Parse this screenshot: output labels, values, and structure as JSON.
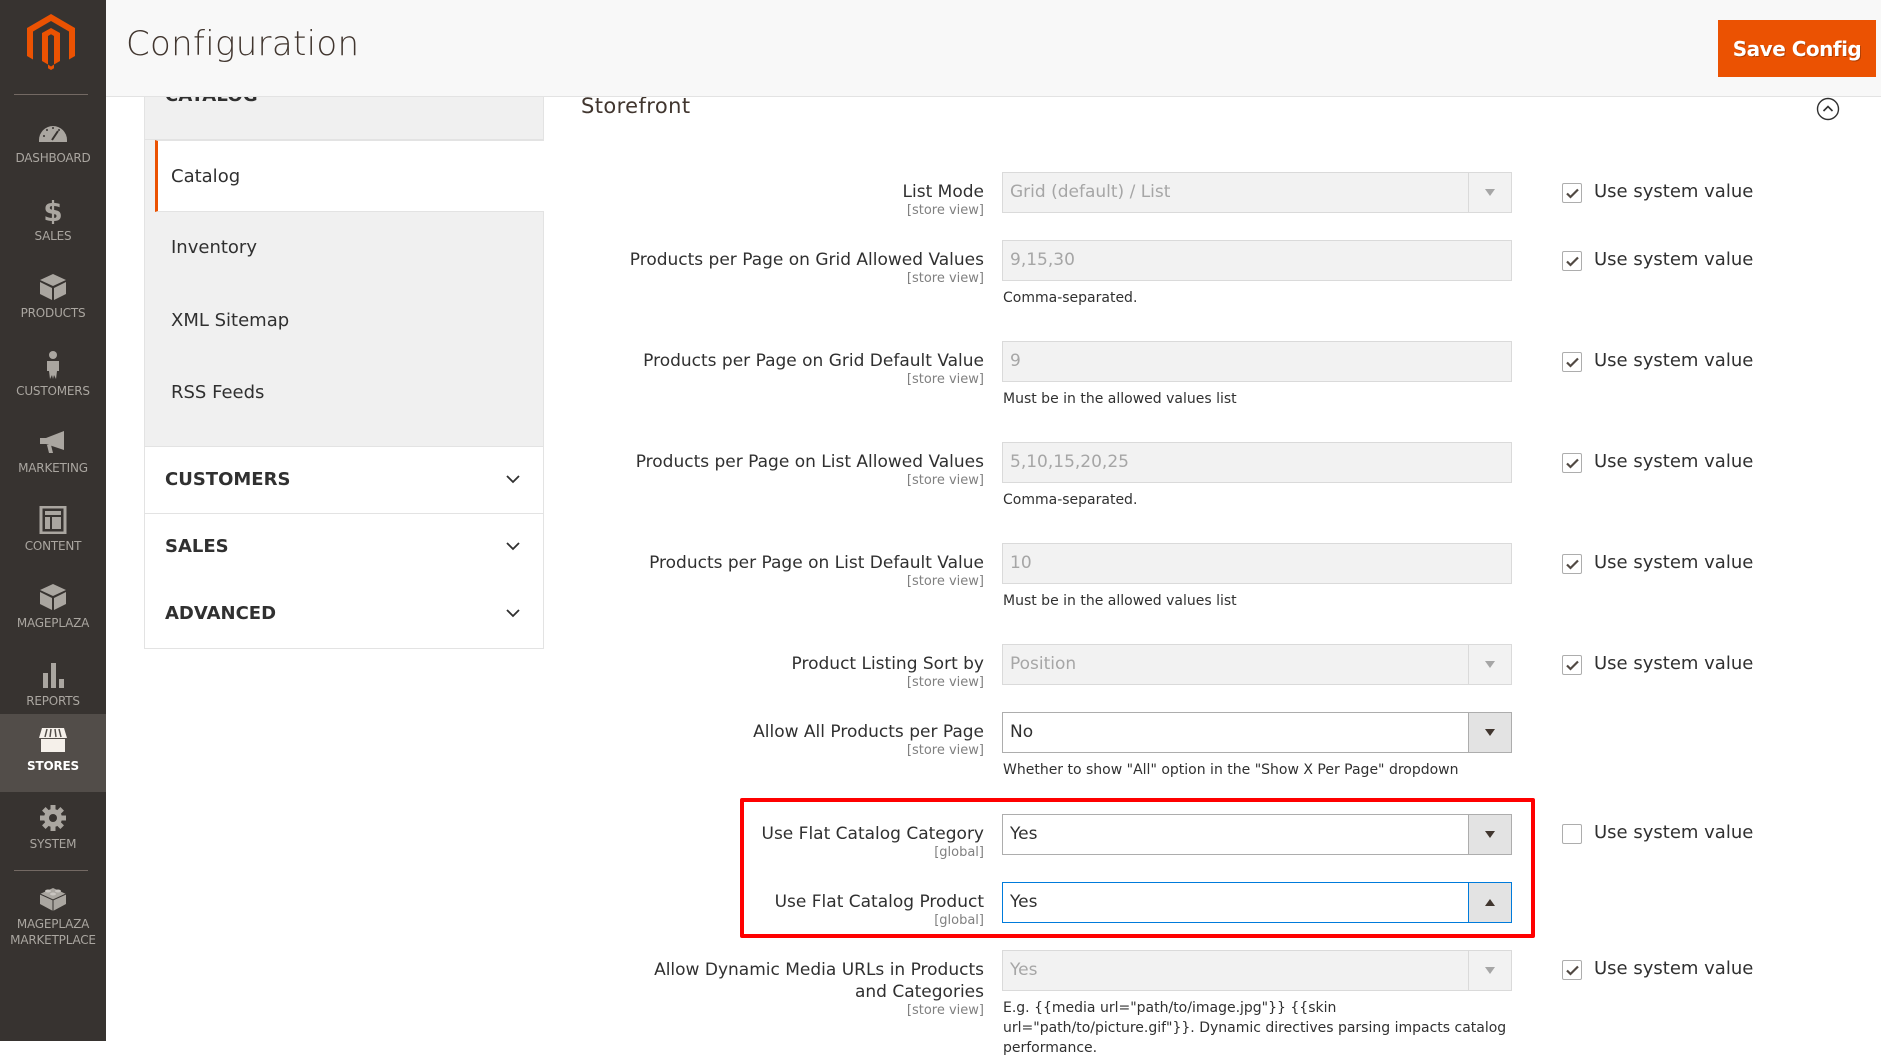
{
  "nav": {
    "items": [
      {
        "label": "DASHBOARD",
        "icon": "dashboard-icon",
        "active": false
      },
      {
        "label": "SALES",
        "icon": "dollar-icon",
        "active": false
      },
      {
        "label": "PRODUCTS",
        "icon": "box-icon",
        "active": false
      },
      {
        "label": "CUSTOMERS",
        "icon": "person-icon",
        "active": false
      },
      {
        "label": "MARKETING",
        "icon": "megaphone-icon",
        "active": false
      },
      {
        "label": "CONTENT",
        "icon": "layout-icon",
        "active": false
      },
      {
        "label": "MAGEPLAZA",
        "icon": "box-icon",
        "active": false
      },
      {
        "label": "REPORTS",
        "icon": "bar-chart-icon",
        "active": false
      },
      {
        "label": "STORES",
        "icon": "storefront-icon",
        "active": true
      },
      {
        "label": "SYSTEM",
        "icon": "gear-icon",
        "active": false
      },
      {
        "label": "MAGEPLAZA MARKETPLACE",
        "icon": "lego-brick-icon",
        "active": false
      }
    ]
  },
  "header": {
    "title": "Configuration",
    "save_label": "Save Config"
  },
  "sidebar": {
    "open_group": "CATALOG",
    "sub_items": [
      {
        "label": "Catalog",
        "active": true
      },
      {
        "label": "Inventory",
        "active": false
      },
      {
        "label": "XML Sitemap",
        "active": false
      },
      {
        "label": "RSS Feeds",
        "active": false
      }
    ],
    "groups": [
      "CUSTOMERS",
      "SALES",
      "ADVANCED"
    ]
  },
  "section": {
    "title": "Storefront",
    "system_value_label": "Use system value",
    "rows": [
      {
        "label": "List Mode",
        "scope": "[store view]",
        "type": "select",
        "value": "Grid (default) / List",
        "disabled": true,
        "note": "",
        "use_system": true
      },
      {
        "label": "Products per Page on Grid Allowed Values",
        "scope": "[store view]",
        "type": "text",
        "value": "9,15,30",
        "disabled": true,
        "note": "Comma-separated.",
        "use_system": true
      },
      {
        "label": "Products per Page on Grid Default Value",
        "scope": "[store view]",
        "type": "text",
        "value": "9",
        "disabled": true,
        "note": "Must be in the allowed values list",
        "use_system": true
      },
      {
        "label": "Products per Page on List Allowed Values",
        "scope": "[store view]",
        "type": "text",
        "value": "5,10,15,20,25",
        "disabled": true,
        "note": "Comma-separated.",
        "use_system": true
      },
      {
        "label": "Products per Page on List Default Value",
        "scope": "[store view]",
        "type": "text",
        "value": "10",
        "disabled": true,
        "note": "Must be in the allowed values list",
        "use_system": true
      },
      {
        "label": "Product Listing Sort by",
        "scope": "[store view]",
        "type": "select",
        "value": "Position",
        "disabled": true,
        "note": "",
        "use_system": true
      },
      {
        "label": "Allow All Products per Page",
        "scope": "[store view]",
        "type": "select",
        "value": "No",
        "disabled": false,
        "note": "Whether to show \"All\" option in the \"Show X Per Page\" dropdown",
        "use_system": null
      },
      {
        "label": "Use Flat Catalog Category",
        "scope": "[global]",
        "type": "select",
        "value": "Yes",
        "disabled": false,
        "note": "",
        "use_system": false
      },
      {
        "label": "Use Flat Catalog Product",
        "scope": "[global]",
        "type": "select",
        "value": "Yes",
        "disabled": false,
        "focused": true,
        "note": "",
        "use_system": null
      },
      {
        "label": "Allow Dynamic Media URLs in Products and Categories",
        "scope": "[store view]",
        "type": "select",
        "value": "Yes",
        "disabled": true,
        "note": "E.g. {{media url=\"path/to/image.jpg\"}} {{skin url=\"path/to/picture.gif\"}}. Dynamic directives parsing impacts catalog performance.",
        "use_system": true
      }
    ]
  },
  "colors": {
    "accent": "#eb5202",
    "nav_bg": "#373330",
    "highlight": "#ff0000",
    "focus": "#007bdb"
  }
}
